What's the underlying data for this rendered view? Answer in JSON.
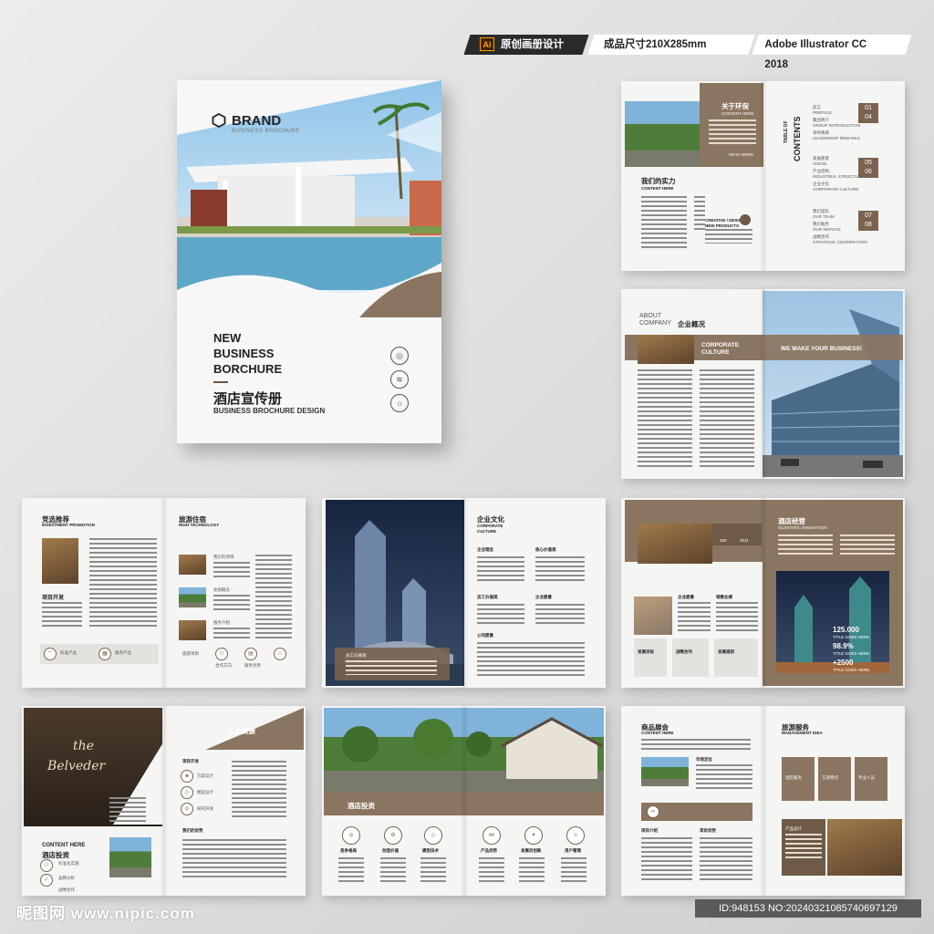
{
  "tags": {
    "ai_label": "Ai",
    "original": "原创画册设计",
    "size": "成品尺寸210X285mm",
    "software": "Adobe Illustrator CC 2018"
  },
  "cover": {
    "brand": "BRAND",
    "brand_sub": "BUSINESS BROCHURE",
    "title_lines": [
      "NEW",
      "BUSINESS",
      "BORCHURE"
    ],
    "title_cn": "酒店宣传册",
    "subtitle": "BUSINESS BROCHURE DESIGN"
  },
  "s1": {
    "h1": "关于环保",
    "h1_sub": "CONTENT HERE",
    "read_more": "READ MORE",
    "h2": "我们的实力",
    "h2_sub": "CONTENT HERE",
    "creative": "CREATIVE / DESIGN",
    "creative_sub": "NEW PRODUCTS",
    "toc_title": "TABLE OF",
    "toc_title2": "CONTENTS",
    "toc": [
      {
        "cn": "前言",
        "en": "PREFACE",
        "n1": "01",
        "n2": "04"
      },
      {
        "cn": "集团简介",
        "en": "GROUP INTRODUCTION"
      },
      {
        "cn": "领导致辞",
        "en": "LEADERSHIP REMARKS"
      },
      {
        "cn": "发展愿景",
        "en": "VISION",
        "n1": "05",
        "n2": "06"
      },
      {
        "cn": "产业结构",
        "en": "INDUSTRIAL STRUCTURE"
      },
      {
        "cn": "企业文化",
        "en": "CORPORATE CULTURE"
      },
      {
        "cn": "我们团队",
        "en": "OUR TEAM",
        "n1": "07",
        "n2": "08"
      },
      {
        "cn": "我们服务",
        "en": "OUR SERVICE"
      },
      {
        "cn": "战略合作",
        "en": "STRATEGIC COOPERATION"
      }
    ]
  },
  "s2": {
    "about1": "ABOUT",
    "about2": "COMPANY",
    "about_cn": "企业概况",
    "culture1": "CORPORATE",
    "culture2": "CULTURE",
    "slogan": "WE MAKE YOUR BUSINESS!"
  },
  "s3": {
    "h1": "竞选推荐",
    "h1_sub": "INVESTMENT PROMOTION",
    "h2": "项目开发",
    "h3": "旅游住宿",
    "h3_sub": "HIGH TECHNOLOGY",
    "items": [
      "我们的项目",
      "住宿概念",
      "服务介绍"
    ],
    "bottom": [
      "标准产品",
      "服务产品"
    ],
    "bottom2": [
      "旅游项目",
      "合作方向",
      "服务优势"
    ]
  },
  "s4": {
    "title": "企业文化",
    "sub1": "CORPORATE",
    "sub2": "CULTURE",
    "items": [
      "企业理念",
      "核心价值观",
      "员工价值观",
      "企业愿景",
      "公司愿景"
    ],
    "caption": "员工价值观"
  },
  "s5": {
    "title": "酒店经营",
    "subtitle": "SCIENTIFIC INNOVATION",
    "stat1": "250",
    "stat2": "2011",
    "s1": "企业愿景",
    "s2": "销售业绩",
    "b": [
      "发展目标",
      "战略合作",
      "发展规划"
    ],
    "big": [
      {
        "v": "125.000",
        "l": "TITLE GOES HERE"
      },
      {
        "v": "98.9%",
        "l": "TITLE GOES HERE"
      },
      {
        "v": "+2500",
        "l": "TITLE GOES HERE"
      }
    ]
  },
  "s6": {
    "sign1": "the",
    "sign2": "Belveder",
    "hr": "人力资源",
    "content": "CONTENT HERE",
    "inv": "酒店投资",
    "left": [
      "标准化实施",
      "品牌分析",
      "战略合作"
    ],
    "right": [
      "项目开发",
      "方案设计",
      "模型设计",
      "研究开发"
    ],
    "adv": "我们的优势"
  },
  "s7": {
    "banner": "酒店投资",
    "items": [
      "竞争格局",
      "创造价值",
      "模型技术",
      "产品优势",
      "发展目创新",
      "用户管理"
    ]
  },
  "s8": {
    "h1": "商品展会",
    "h1_sub": "CONTENT HERE",
    "market": "市场定位",
    "b1": "项目介绍",
    "b2": "项目优势",
    "h2": "旅游服务",
    "h2_sub": "MANAGEMENT IDEA",
    "cards": [
      "酒店服务",
      "方案特点",
      "专业人员",
      "综合优势"
    ],
    "product": "产品设计"
  },
  "watermark": "昵图网 www.nipic.com",
  "id_text": "ID:948153 NO:20240321085740697129"
}
